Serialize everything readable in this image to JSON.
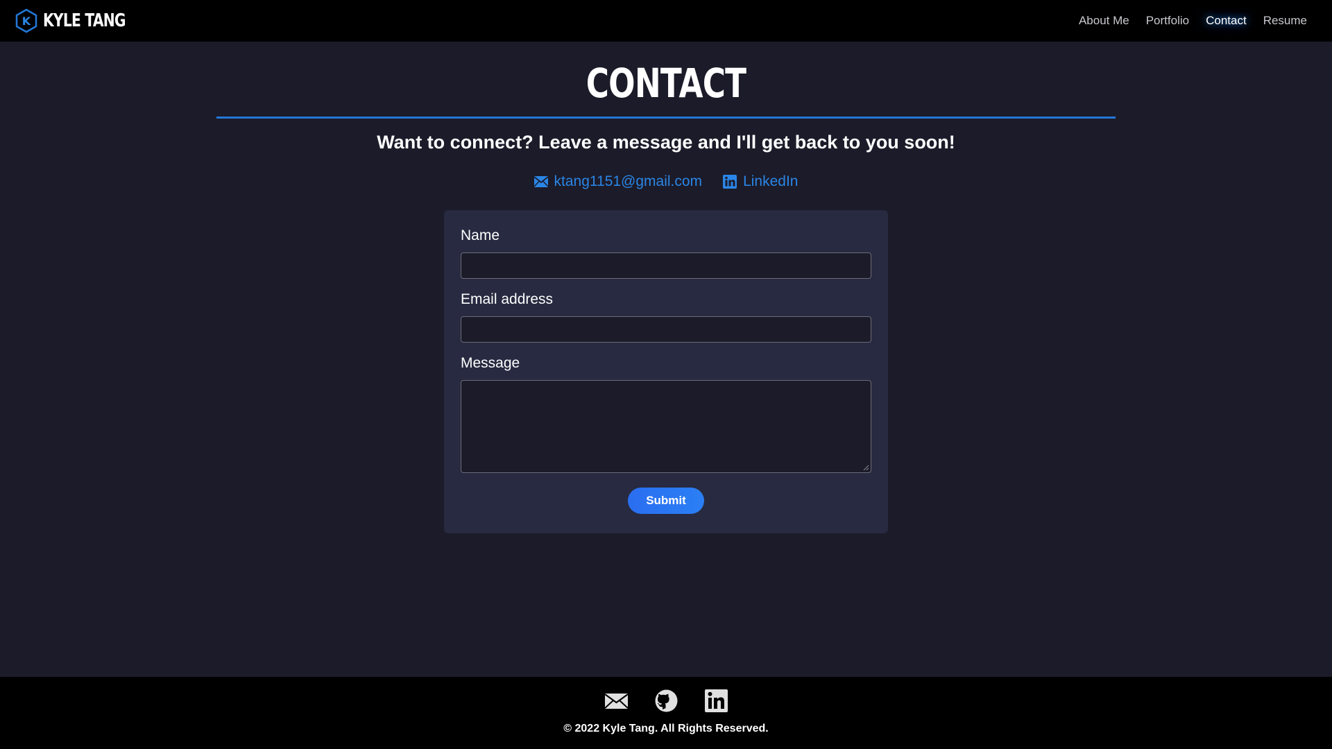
{
  "navbar": {
    "brand_name": "KYLE TANG",
    "brand_logo_letter": "K",
    "links": [
      {
        "label": "About Me",
        "active": false
      },
      {
        "label": "Portfolio",
        "active": false
      },
      {
        "label": "Contact",
        "active": true
      },
      {
        "label": "Resume",
        "active": false
      }
    ]
  },
  "main": {
    "title": "CONTACT",
    "tagline": "Want to connect? Leave a message and I'll get back to you soon!",
    "contact_links": {
      "email": {
        "label": "ktang1151@gmail.com",
        "icon": "envelope-icon"
      },
      "linkedin": {
        "label": "LinkedIn",
        "icon": "linkedin-icon"
      }
    }
  },
  "form": {
    "name_label": "Name",
    "name_value": "",
    "email_label": "Email address",
    "email_value": "",
    "message_label": "Message",
    "message_value": "",
    "submit_label": "Submit"
  },
  "footer": {
    "icons": [
      "envelope-icon",
      "github-icon",
      "linkedin-icon"
    ],
    "copyright": "© 2022 Kyle Tang. All Rights Reserved."
  },
  "colors": {
    "background": "#1c1b29",
    "navbar": "#000000",
    "card": "#272a40",
    "accent": "#2378d8",
    "link": "#2a86e6",
    "button": "#2a6ef0"
  }
}
